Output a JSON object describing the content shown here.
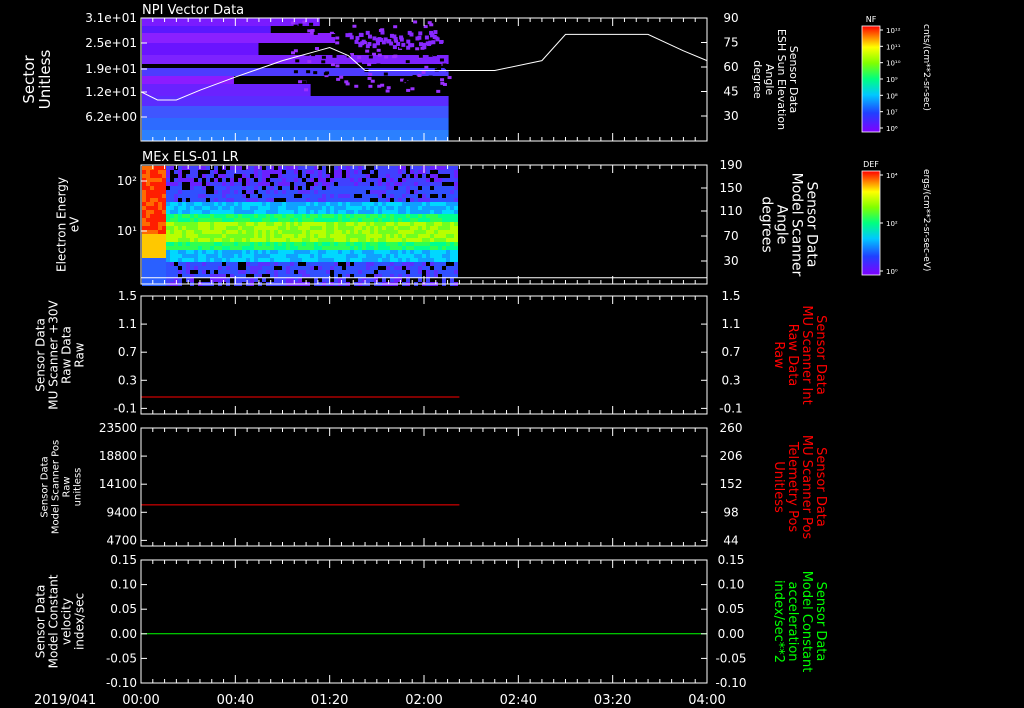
{
  "date_label": "2019/041",
  "time_ticks": [
    "00:00",
    "00:40",
    "01:20",
    "02:00",
    "02:40",
    "03:20",
    "04:00"
  ],
  "colors": {
    "background": "#000000",
    "axes": "#ffffff",
    "red_series": "#ff0000",
    "green_series": "#00ff00",
    "trace": "#ffffff"
  },
  "colorbars": [
    {
      "top_label": "NF",
      "unit_label": "cnts/(cm**2-sr-sec)",
      "tick_labels": [
        "10¹²",
        "10¹¹",
        "10¹⁰",
        "10⁹",
        "10⁸",
        "10⁷",
        "10⁶"
      ]
    },
    {
      "top_label": "DEF",
      "unit_label": "ergs/(cm**2-sr-sec-eV)",
      "tick_labels": [
        "10⁴",
        "10²",
        "10⁰"
      ]
    }
  ],
  "chart_data": [
    {
      "type": "heatmap",
      "title": "NPI Vector Data",
      "ylabel_left": [
        "Sector",
        "Unitless"
      ],
      "ylabel_right": [
        "Sensor Data",
        "ESH Sun Elevation",
        "Angle",
        "degree"
      ],
      "yticks_left": [
        "3.1e+01",
        "2.5e+01",
        "1.9e+01",
        "1.2e+01",
        "6.2e+00"
      ],
      "yticks_right": [
        "90",
        "75",
        "60",
        "45",
        "30"
      ],
      "y_right_lim": [
        15,
        90
      ],
      "data_end_time": "02:10",
      "overlay_line": {
        "name": "ESH Sun Elevation Angle",
        "x": [
          "00:00",
          "00:07",
          "00:15",
          "00:25",
          "00:40",
          "01:00",
          "01:15",
          "01:20",
          "01:28",
          "01:35",
          "02:00",
          "02:30",
          "02:50",
          "03:00",
          "03:20",
          "03:35",
          "03:50",
          "04:00"
        ],
        "y": [
          45,
          40,
          40,
          46,
          54,
          64,
          70,
          72,
          67,
          58,
          58,
          58,
          64,
          80,
          80,
          80,
          70,
          64
        ]
      }
    },
    {
      "type": "heatmap",
      "title": "MEx ELS-01 LR",
      "ylabel_left": [
        "Electron Energy",
        "eV"
      ],
      "ylabel_right": [
        "Sensor Data",
        "Model Scanner",
        "Angle",
        "degrees"
      ],
      "yticks_left": [
        "10²",
        "10¹"
      ],
      "yticks_right": [
        "190",
        "150",
        "110",
        "70",
        "30"
      ],
      "y_right_lim": [
        0,
        190
      ],
      "data_end_time": "02:13",
      "overlay_line": {
        "name": "Model Scanner Angle",
        "x": [
          "00:00",
          "04:00"
        ],
        "y": [
          10,
          10
        ]
      }
    },
    {
      "type": "line",
      "ylabel_left": [
        "Sensor Data",
        "MU Scanner +30V",
        "Raw Data",
        "Raw"
      ],
      "ylabel_right": [
        "Sensor Data",
        "MU Scanner Int",
        "Raw Data",
        "Raw"
      ],
      "yticks_left": [
        "1.5",
        "1.1",
        "0.7",
        "0.3",
        "-0.1"
      ],
      "yticks_right": [
        "1.5",
        "1.1",
        "0.7",
        "0.3",
        "-0.1"
      ],
      "ylim": [
        -0.3,
        1.5
      ],
      "series": [
        {
          "x": [
            "00:00",
            "02:15"
          ],
          "y": [
            -0.04,
            -0.04
          ]
        }
      ]
    },
    {
      "type": "line",
      "ylabel_left": [
        "Sensor Data",
        "Model Scanner Pos",
        "Raw",
        "unitless"
      ],
      "ylabel_right": [
        "Sensor Data",
        "MU Scanner Pos",
        "Telemetry Pos",
        "Unitless"
      ],
      "yticks_left": [
        "23500",
        "18800",
        "14100",
        "9400",
        "4700"
      ],
      "yticks_right": [
        "260",
        "206",
        "152",
        "98",
        "44"
      ],
      "ylim": [
        0,
        23500
      ],
      "series": [
        {
          "x": [
            "00:00",
            "02:15"
          ],
          "y": [
            8200,
            8200
          ]
        }
      ]
    },
    {
      "type": "line",
      "ylabel_left": [
        "Sensor Data",
        "Model Constant",
        "velocity",
        "index/sec"
      ],
      "ylabel_right": [
        "Sensor Data",
        "Model Constant",
        "acceleration",
        "index/sec**2"
      ],
      "yticks_left": [
        "0.15",
        "0.10",
        "0.05",
        "0.00",
        "-0.05",
        "-0.10"
      ],
      "yticks_right": [
        "0.15",
        "0.10",
        "0.05",
        "0.00",
        "-0.05",
        "-0.10"
      ],
      "ylim": [
        -0.1,
        0.15
      ],
      "series": [
        {
          "x": [
            "00:00",
            "04:00"
          ],
          "y": [
            0,
            0
          ]
        }
      ]
    }
  ]
}
